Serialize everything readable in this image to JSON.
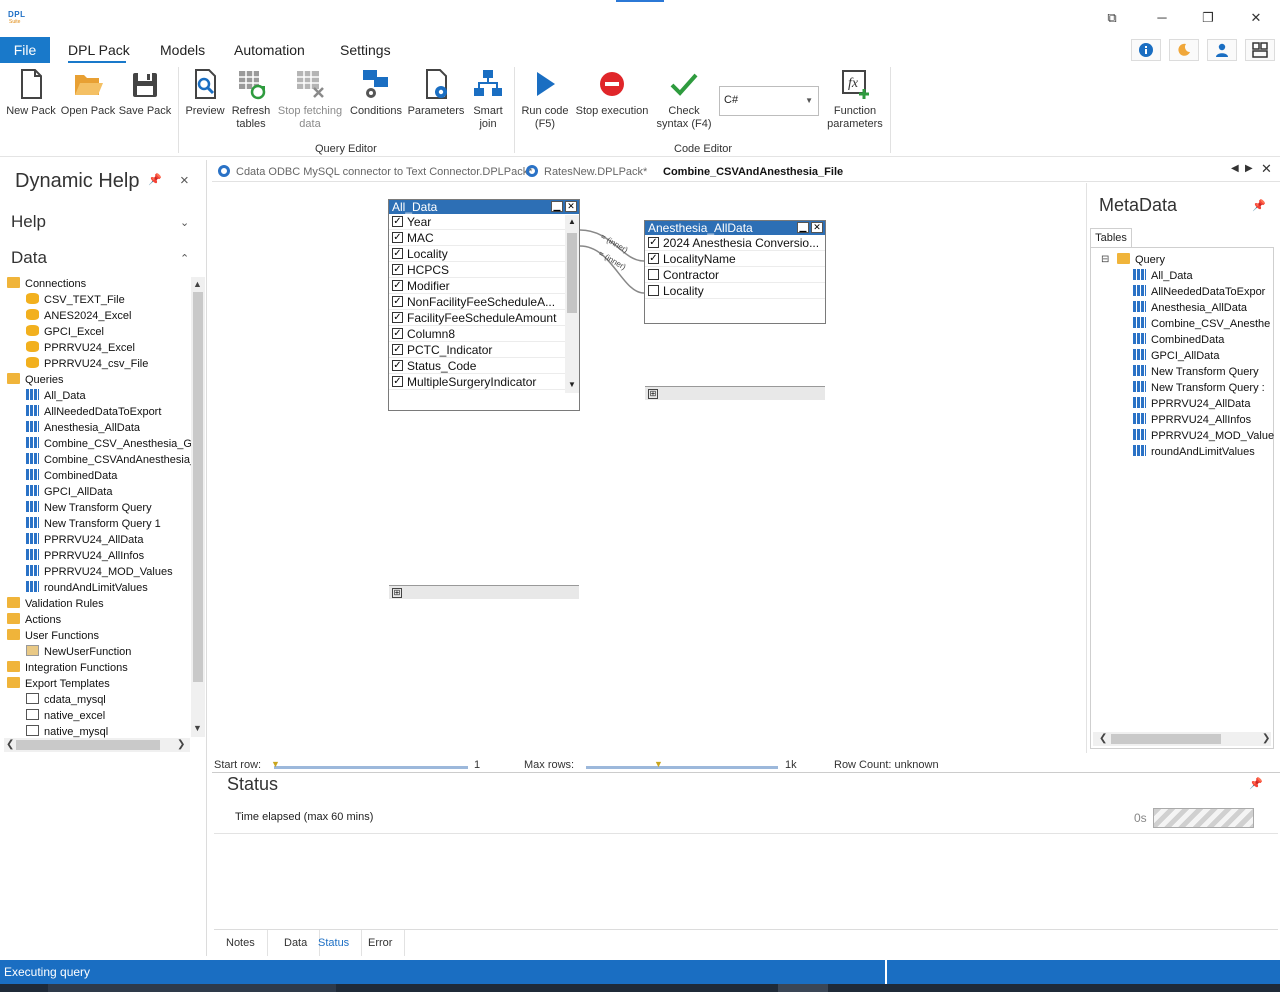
{
  "window": {
    "logo_line1": "DPL",
    "logo_line2": "Suite",
    "controls": {
      "restore_down": "⧉",
      "minimize": "─",
      "maximize": "❐",
      "close": "✕"
    }
  },
  "menu": {
    "tabs": [
      "File",
      "DPL Pack",
      "Models",
      "Automation",
      "Settings"
    ],
    "right_buttons": [
      "info-icon",
      "theme-moon-icon",
      "user-icon",
      "layout-icon"
    ]
  },
  "ribbon": {
    "pack_group": [
      {
        "label": "New Pack",
        "icon": "new-document-icon"
      },
      {
        "label": "Open Pack",
        "icon": "folder-open-icon"
      },
      {
        "label": "Save Pack",
        "icon": "save-icon"
      }
    ],
    "query_editor": {
      "label": "Query Editor",
      "buttons": [
        {
          "label": "Preview",
          "icon": "preview-icon",
          "enabled": true
        },
        {
          "label": "Refresh\ntables",
          "icon": "refresh-tables-icon",
          "enabled": true
        },
        {
          "label": "Stop fetching\ndata",
          "icon": "stop-fetching-icon",
          "enabled": false
        },
        {
          "label": "Conditions",
          "icon": "conditions-icon",
          "enabled": true
        },
        {
          "label": "Parameters",
          "icon": "parameters-icon",
          "enabled": true
        },
        {
          "label": "Smart\njoin",
          "icon": "smart-join-icon",
          "enabled": true
        }
      ]
    },
    "code_editor": {
      "label": "Code Editor",
      "buttons": [
        {
          "label": "Run code\n(F5)",
          "icon": "run-icon"
        },
        {
          "label": "Stop execution",
          "icon": "stop-icon"
        },
        {
          "label": "Check\nsyntax (F4)",
          "icon": "check-icon"
        }
      ],
      "language": "C#",
      "function_button": {
        "label": "Function\nparameters",
        "icon": "function-icon"
      }
    }
  },
  "left_panel": {
    "title": "Dynamic Help",
    "help_header": "Help",
    "data_header": "Data",
    "tree": [
      {
        "level": 0,
        "icon": "folder",
        "label": "Connections"
      },
      {
        "level": 1,
        "icon": "db",
        "label": "CSV_TEXT_File"
      },
      {
        "level": 1,
        "icon": "db",
        "label": "ANES2024_Excel"
      },
      {
        "level": 1,
        "icon": "db",
        "label": "GPCI_Excel"
      },
      {
        "level": 1,
        "icon": "db",
        "label": "PPRRVU24_Excel"
      },
      {
        "level": 1,
        "icon": "db",
        "label": "PPRRVU24_csv_File"
      },
      {
        "level": 0,
        "icon": "folder",
        "label": "Queries"
      },
      {
        "level": 1,
        "icon": "grid",
        "label": "All_Data"
      },
      {
        "level": 1,
        "icon": "grid",
        "label": "AllNeededDataToExport"
      },
      {
        "level": 1,
        "icon": "grid",
        "label": "Anesthesia_AllData"
      },
      {
        "level": 1,
        "icon": "grid",
        "label": "Combine_CSV_Anesthesia_GP"
      },
      {
        "level": 1,
        "icon": "grid",
        "label": "Combine_CSVAndAnesthesia_"
      },
      {
        "level": 1,
        "icon": "grid",
        "label": "CombinedData"
      },
      {
        "level": 1,
        "icon": "grid",
        "label": "GPCI_AllData"
      },
      {
        "level": 1,
        "icon": "grid",
        "label": "New Transform Query"
      },
      {
        "level": 1,
        "icon": "grid",
        "label": "New Transform Query 1"
      },
      {
        "level": 1,
        "icon": "grid",
        "label": "PPRRVU24_AllData"
      },
      {
        "level": 1,
        "icon": "grid",
        "label": "PPRRVU24_AllInfos"
      },
      {
        "level": 1,
        "icon": "grid",
        "label": "PPRRVU24_MOD_Values"
      },
      {
        "level": 1,
        "icon": "grid",
        "label": "roundAndLimitValues"
      },
      {
        "level": 0,
        "icon": "folder",
        "label": "Validation Rules"
      },
      {
        "level": 0,
        "icon": "folder",
        "label": "Actions"
      },
      {
        "level": 0,
        "icon": "folder",
        "label": "User Functions"
      },
      {
        "level": 1,
        "icon": "fn",
        "label": "NewUserFunction"
      },
      {
        "level": 0,
        "icon": "folder",
        "label": "Integration Functions"
      },
      {
        "level": 0,
        "icon": "folder",
        "label": "Export Templates"
      },
      {
        "level": 1,
        "icon": "exp",
        "label": "cdata_mysql"
      },
      {
        "level": 1,
        "icon": "exp",
        "label": "native_excel"
      },
      {
        "level": 1,
        "icon": "exp",
        "label": "native_mysql"
      }
    ]
  },
  "doc_tabs": [
    {
      "label": "Cdata ODBC MySQL connector to Text Connector.DPLPack*",
      "active": false
    },
    {
      "label": "RatesNew.DPLPack*",
      "active": false
    },
    {
      "label": "Combine_CSVAndAnesthesia_File",
      "active": true
    }
  ],
  "query_canvas": {
    "table1": {
      "title": "All_Data",
      "fields": [
        {
          "name": "Year",
          "checked": true
        },
        {
          "name": "MAC",
          "checked": true
        },
        {
          "name": "Locality",
          "checked": true
        },
        {
          "name": "HCPCS",
          "checked": true
        },
        {
          "name": "Modifier",
          "checked": true
        },
        {
          "name": "NonFacilityFeeScheduleA...",
          "checked": true
        },
        {
          "name": "FacilityFeeScheduleAmount",
          "checked": true
        },
        {
          "name": "Column8",
          "checked": true
        },
        {
          "name": "PCTC_Indicator",
          "checked": true
        },
        {
          "name": "Status_Code",
          "checked": true
        },
        {
          "name": "MultipleSurgeryIndicator",
          "checked": true
        }
      ]
    },
    "table2": {
      "title": "Anesthesia_AllData",
      "fields": [
        {
          "name": "2024 Anesthesia Conversio...",
          "checked": true
        },
        {
          "name": "LocalityName",
          "checked": true
        },
        {
          "name": "Contractor",
          "checked": false
        },
        {
          "name": "Locality",
          "checked": false
        }
      ]
    },
    "joins": [
      "= (inner)",
      "= (inner)"
    ]
  },
  "rows_bar": {
    "start_row_label": "Start row:",
    "start_row_value": "1",
    "max_rows_label": "Max rows:",
    "max_rows_value": "1k",
    "row_count": "Row Count: unknown"
  },
  "status_panel": {
    "title": "Status",
    "time_label": "Time elapsed (max 60 mins)",
    "time_value": "0s",
    "tabs": [
      "Notes",
      "Data",
      "Status",
      "Error"
    ],
    "active_tab": "Status"
  },
  "metadata": {
    "title": "MetaData",
    "tab": "Tables",
    "root": "Query",
    "items": [
      "All_Data",
      "AllNeededDataToExpor",
      "Anesthesia_AllData",
      "Combine_CSV_Anesthe",
      "CombinedData",
      "GPCI_AllData",
      "New Transform Query",
      "New Transform Query :",
      "PPRRVU24_AllData",
      "PPRRVU24_AllInfos",
      "PPRRVU24_MOD_Value",
      "roundAndLimitValues"
    ]
  },
  "statusbar": {
    "text": "Executing query"
  },
  "colors": {
    "accent": "#1979ca",
    "table_title": "#2d6fb5",
    "statusbar": "#1a6ec2"
  }
}
